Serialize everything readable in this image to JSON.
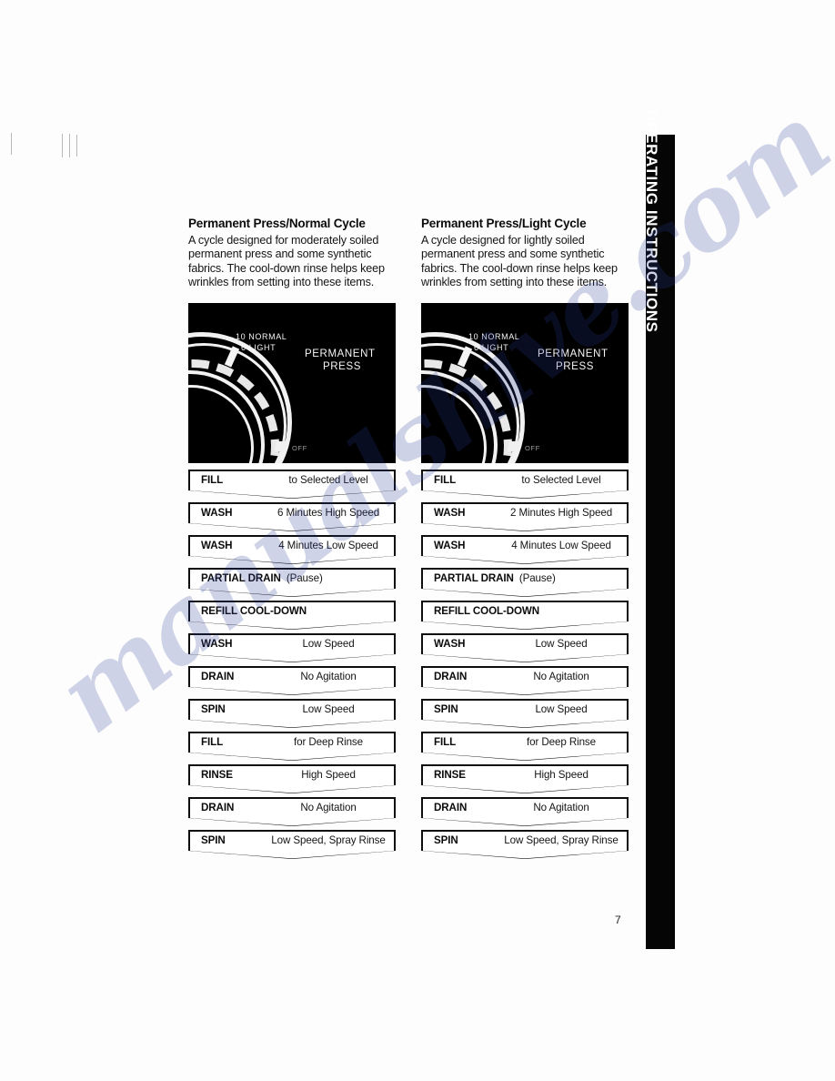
{
  "side_tab": {
    "label": "OPERATING INSTRUCTIONS"
  },
  "watermark": {
    "text": "manualshive.com"
  },
  "page_number": "7",
  "columns": [
    {
      "title": "Permanent Press/Normal Cycle",
      "description": "A cycle designed for moderately soiled permanent press and some synthetic fabrics. The cool-down rinse helps keep wrinkles from setting into these items.",
      "dial": {
        "scale_top": "10 NORMAL",
        "scale_bottom": "6 LIGHT",
        "cycle_line1": "PERMANENT",
        "cycle_line2": "PRESS",
        "off_label": "OFF"
      },
      "steps": [
        {
          "action": "FILL",
          "detail": "to Selected Level",
          "wide": false
        },
        {
          "action": "WASH",
          "detail": "6 Minutes High Speed",
          "wide": false
        },
        {
          "action": "WASH",
          "detail": "4 Minutes Low Speed",
          "wide": false
        },
        {
          "action": "PARTIAL DRAIN",
          "detail": "(Pause)",
          "wide": true
        },
        {
          "action": "REFILL COOL-DOWN",
          "detail": "",
          "wide": true
        },
        {
          "action": "WASH",
          "detail": "Low Speed",
          "wide": false
        },
        {
          "action": "DRAIN",
          "detail": "No Agitation",
          "wide": false
        },
        {
          "action": "SPIN",
          "detail": "Low Speed",
          "wide": false
        },
        {
          "action": "FILL",
          "detail": "for Deep Rinse",
          "wide": false
        },
        {
          "action": "RINSE",
          "detail": "High Speed",
          "wide": false
        },
        {
          "action": "DRAIN",
          "detail": "No Agitation",
          "wide": false
        },
        {
          "action": "SPIN",
          "detail": "Low Speed, Spray Rinse",
          "wide": false
        }
      ]
    },
    {
      "title": "Permanent Press/Light Cycle",
      "description": "A cycle designed for lightly soiled permanent press and some synthetic fabrics. The cool-down rinse helps keep wrinkles from setting into these items.",
      "dial": {
        "scale_top": "10 NORMAL",
        "scale_bottom": "6 LIGHT",
        "cycle_line1": "PERMANENT",
        "cycle_line2": "PRESS",
        "off_label": "OFF"
      },
      "steps": [
        {
          "action": "FILL",
          "detail": "to Selected Level",
          "wide": false
        },
        {
          "action": "WASH",
          "detail": "2 Minutes High Speed",
          "wide": false
        },
        {
          "action": "WASH",
          "detail": "4 Minutes Low Speed",
          "wide": false
        },
        {
          "action": "PARTIAL DRAIN",
          "detail": "(Pause)",
          "wide": true
        },
        {
          "action": "REFILL COOL-DOWN",
          "detail": "",
          "wide": true
        },
        {
          "action": "WASH",
          "detail": "Low Speed",
          "wide": false
        },
        {
          "action": "DRAIN",
          "detail": "No Agitation",
          "wide": false
        },
        {
          "action": "SPIN",
          "detail": "Low Speed",
          "wide": false
        },
        {
          "action": "FILL",
          "detail": "for Deep Rinse",
          "wide": false
        },
        {
          "action": "RINSE",
          "detail": "High Speed",
          "wide": false
        },
        {
          "action": "DRAIN",
          "detail": "No Agitation",
          "wide": false
        },
        {
          "action": "SPIN",
          "detail": "Low Speed, Spray Rinse",
          "wide": false
        }
      ]
    }
  ]
}
